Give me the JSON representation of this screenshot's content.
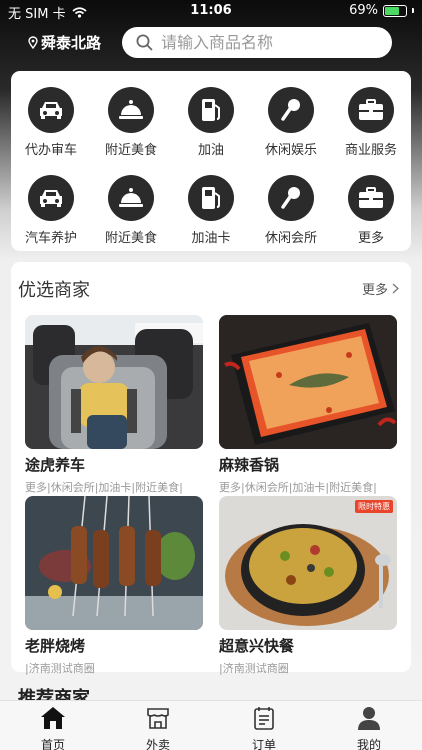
{
  "status_bar": {
    "carrier": "无 SIM 卡",
    "time": "11:06",
    "battery": "69%",
    "battery_level": 0.69
  },
  "header": {
    "location": "舜泰北路",
    "search_placeholder": "请输入商品名称"
  },
  "services": [
    {
      "label": "代办审车",
      "icon": "car-icon"
    },
    {
      "label": "附近美食",
      "icon": "food-cloche-icon"
    },
    {
      "label": "加油",
      "icon": "fuel-pump-icon"
    },
    {
      "label": "休闲娱乐",
      "icon": "microphone-icon"
    },
    {
      "label": "商业服务",
      "icon": "briefcase-icon"
    },
    {
      "label": "汽车养护",
      "icon": "car-icon"
    },
    {
      "label": "附近美食",
      "icon": "food-cloche-icon"
    },
    {
      "label": "加油卡",
      "icon": "fuel-pump-icon"
    },
    {
      "label": "休闲会所",
      "icon": "microphone-icon"
    },
    {
      "label": "更多",
      "icon": "briefcase-icon"
    }
  ],
  "featured": {
    "title": "优选商家",
    "more": "更多",
    "merchants": [
      {
        "name": "途虎养车",
        "tags": "更多|休闲会所|加油卡|附近美食|",
        "image": "child-in-car-seat-photo"
      },
      {
        "name": "麻辣香锅",
        "tags": "更多|休闲会所|加油卡|附近美食|",
        "image": "hot-pot-photo"
      },
      {
        "name": "老胖烧烤",
        "tags": "|济南测试商圈",
        "image": "bbq-skewers-photo"
      },
      {
        "name": "超意兴快餐",
        "tags": "|济南测试商圈",
        "image": "fried-rice-photo",
        "badge": "限时特惠"
      }
    ]
  },
  "section2_title": "推荐商家",
  "tabbar": [
    {
      "label": "首页",
      "icon": "home-icon"
    },
    {
      "label": "外卖",
      "icon": "store-icon"
    },
    {
      "label": "订单",
      "icon": "order-list-icon"
    },
    {
      "label": "我的",
      "icon": "user-icon"
    }
  ]
}
